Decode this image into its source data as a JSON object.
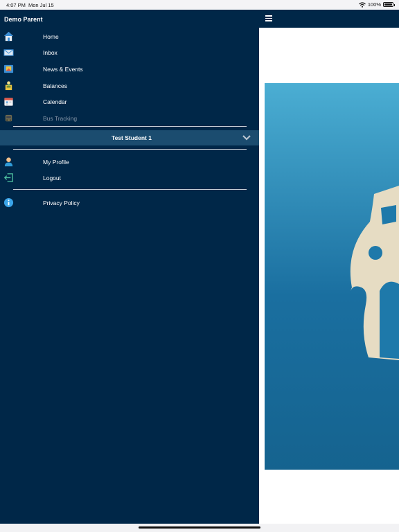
{
  "status_bar": {
    "time": "4:07 PM",
    "date": "Mon Jul 15",
    "battery": "100%",
    "battery_level": 1.0
  },
  "drawer": {
    "title": "Demo Parent",
    "items": [
      {
        "label": "Home",
        "icon": "home-icon"
      },
      {
        "label": "Inbox",
        "icon": "mail-icon"
      },
      {
        "label": "News & Events",
        "icon": "news-icon"
      },
      {
        "label": "Balances",
        "icon": "balances-icon"
      },
      {
        "label": "Calendar",
        "icon": "calendar-icon"
      },
      {
        "label": "Bus Tracking",
        "icon": "bus-icon",
        "disabled": true
      }
    ],
    "student": {
      "label": "Test Student 1",
      "icon": "chevron-down-icon"
    },
    "account_items": [
      {
        "label": "My Profile",
        "icon": "profile-icon"
      },
      {
        "label": "Logout",
        "icon": "logout-icon"
      }
    ],
    "footer_items": [
      {
        "label": "Privacy Policy",
        "icon": "info-icon"
      }
    ]
  },
  "main": {
    "menu_icon": "hamburger-icon"
  },
  "colors": {
    "drawer_bg": "#002748",
    "student_bar": "#1b4c6f",
    "banner_top": "#4baed3",
    "banner_bottom": "#15638f"
  }
}
